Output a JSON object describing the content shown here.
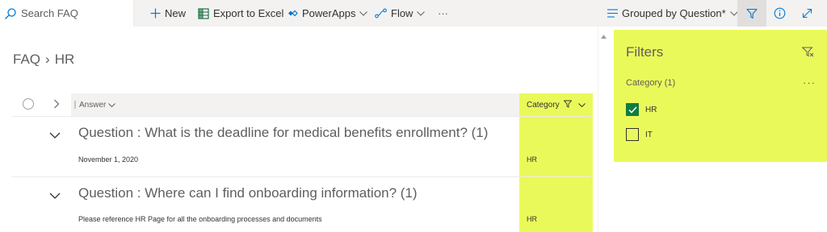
{
  "search": {
    "placeholder": "Search FAQ"
  },
  "commands": {
    "new": "New",
    "export": "Export to Excel",
    "powerapps": "PowerApps",
    "flow": "Flow",
    "more": "···",
    "view": "Grouped by Question*"
  },
  "breadcrumb": {
    "site": "FAQ",
    "separator": "›",
    "list": "HR"
  },
  "columns": {
    "answer": "Answer",
    "category": "Category"
  },
  "groups": [
    {
      "title": "Question : What is the deadline for medical benefits enrollment? (1)",
      "rows": [
        {
          "answer": "November 1, 2020",
          "category": "HR"
        }
      ]
    },
    {
      "title": "Question : Where can I find onboarding information? (1)",
      "rows": [
        {
          "answer": "Please reference HR Page for all the onboarding processes and documents",
          "category": "HR"
        }
      ]
    }
  ],
  "filters": {
    "title": "Filters",
    "category_label": "Category (1)",
    "more": "···",
    "options": [
      {
        "label": "HR",
        "checked": true
      },
      {
        "label": "IT",
        "checked": false
      }
    ]
  },
  "colors": {
    "highlight": "#eaf95a",
    "accent": "#0078d4",
    "checked": "#107c41",
    "excel": "#217346"
  }
}
